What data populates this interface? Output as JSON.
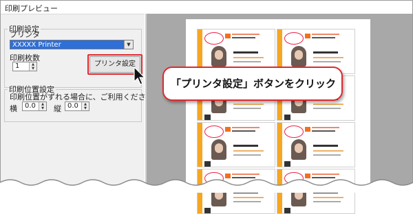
{
  "window": {
    "title": "印刷プレビュー"
  },
  "print_settings": {
    "group_label": "印刷設定",
    "printer_label": "プリンタ",
    "printer_value": "XXXXX Printer",
    "copies_label": "印刷枚数",
    "copies_value": "1",
    "printer_setup_button": "プリンタ設定"
  },
  "position_settings": {
    "group_label": "印刷位置設定",
    "note": "印刷位置がずれる場合に、ご利用ください。",
    "horizontal_label": "横",
    "horizontal_value": "0.0",
    "vertical_label": "縦",
    "vertical_value": "0.0"
  },
  "callout": {
    "text": "「プリンタ設定」ボタンをクリック"
  },
  "colors": {
    "highlight": "#e0282d",
    "select_bg": "#2e6fd8",
    "card_accent": "#f5a623"
  },
  "icons": {
    "cursor": "arrow-cursor-icon"
  }
}
